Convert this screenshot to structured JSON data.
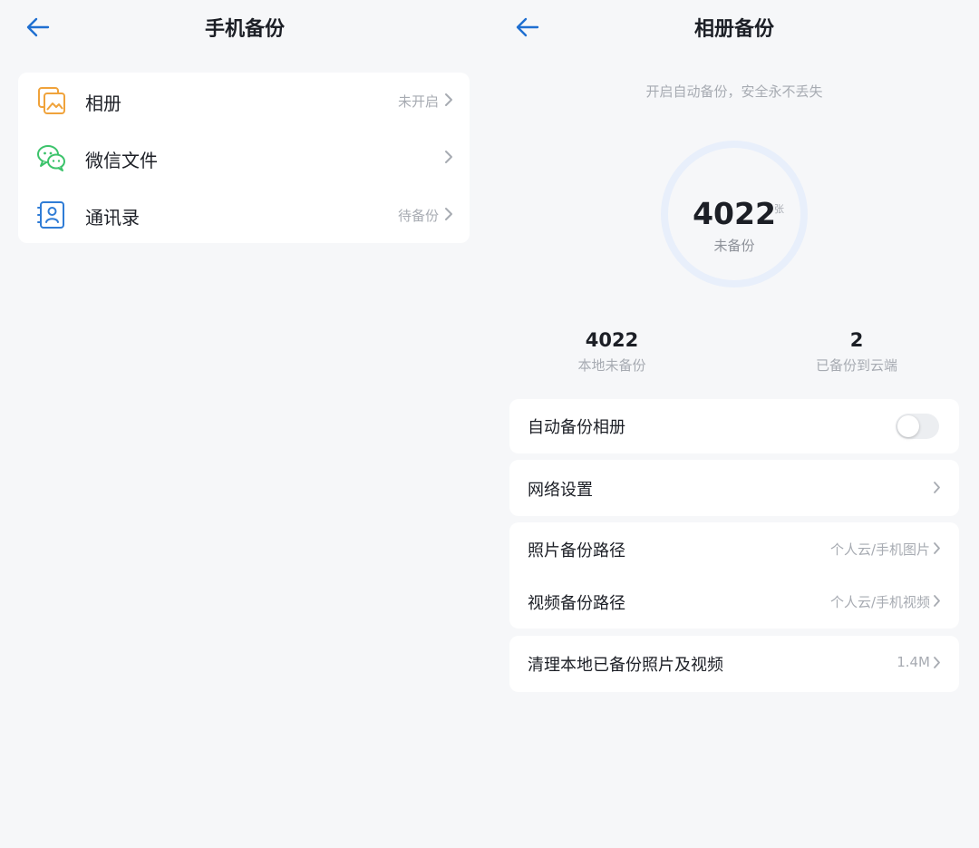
{
  "colors": {
    "accent": "#1f6fd1",
    "background": "#f6f7f9",
    "card": "#ffffff",
    "muted_text": "#a7abb2",
    "album_icon": "#f0a33b",
    "wechat_icon": "#3cc36b",
    "contacts_icon": "#2f7cd6",
    "ring": "#e8effb"
  },
  "left": {
    "title": "手机备份",
    "back_icon": "arrow-left-icon",
    "items": [
      {
        "label": "相册",
        "status": "未开启",
        "icon": "album-icon"
      },
      {
        "label": "微信文件",
        "status": "",
        "icon": "wechat-icon"
      },
      {
        "label": "通讯录",
        "status": "待备份",
        "icon": "contacts-icon"
      }
    ]
  },
  "right": {
    "title": "相册备份",
    "back_icon": "arrow-left-icon",
    "subtitle": "开启自动备份，安全永不丢失",
    "ring": {
      "count": "4022",
      "unit": "张",
      "label": "未备份",
      "backed_up_fraction": 0
    },
    "stats": [
      {
        "value": "4022",
        "label": "本地未备份"
      },
      {
        "value": "2",
        "label": "已备份到云端"
      }
    ],
    "settings": {
      "auto_backup": {
        "label": "自动备份相册",
        "enabled": false
      },
      "network": {
        "label": "网络设置"
      },
      "photo_path": {
        "label": "照片备份路径",
        "value": "个人云/手机图片"
      },
      "video_path": {
        "label": "视频备份路径",
        "value": "个人云/手机视频"
      },
      "cleanup": {
        "label": "清理本地已备份照片及视频",
        "value": "1.4M"
      }
    }
  }
}
